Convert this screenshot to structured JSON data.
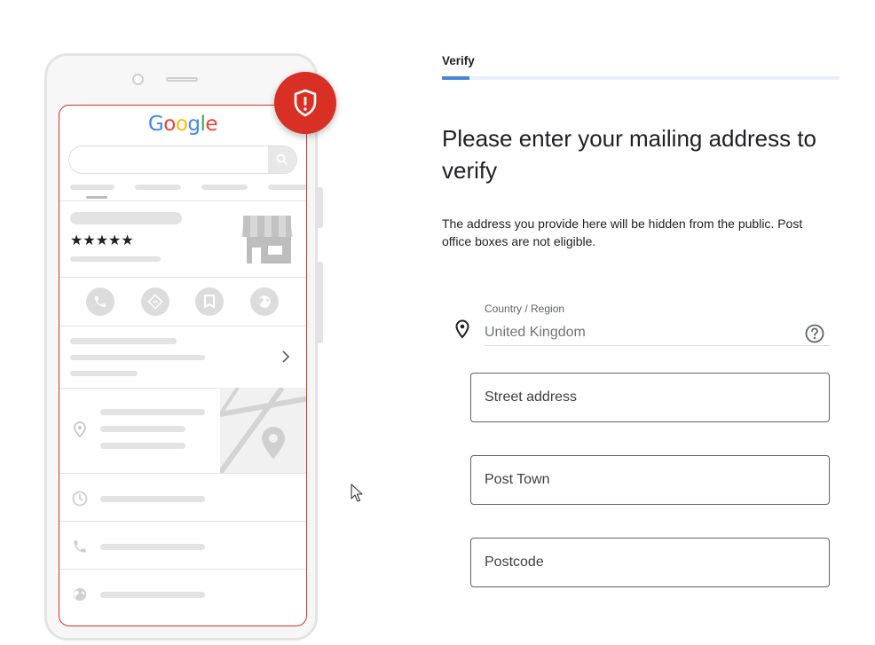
{
  "illustration": {
    "brand_letters": [
      {
        "char": "G",
        "color": "#4285F4"
      },
      {
        "char": "o",
        "color": "#EA4335"
      },
      {
        "char": "o",
        "color": "#FBBC05"
      },
      {
        "char": "g",
        "color": "#4285F4"
      },
      {
        "char": "l",
        "color": "#34A853"
      },
      {
        "char": "e",
        "color": "#EA4335"
      }
    ],
    "rating_stars": "★★★★★",
    "badge_icon": "shield-alert-icon",
    "accent_color": "#d93025"
  },
  "form": {
    "step_label": "Verify",
    "progress": 0.07,
    "heading": "Please enter your mailing address to verify",
    "description": "The address you provide here will be hidden from the public. Post office boxes are not eligible.",
    "country": {
      "label": "Country / Region",
      "value": "United Kingdom",
      "icon": "location-pin-icon",
      "help_icon": "help-icon"
    },
    "fields": {
      "street": "Street address",
      "town": "Post Town",
      "postcode": "Postcode"
    }
  }
}
